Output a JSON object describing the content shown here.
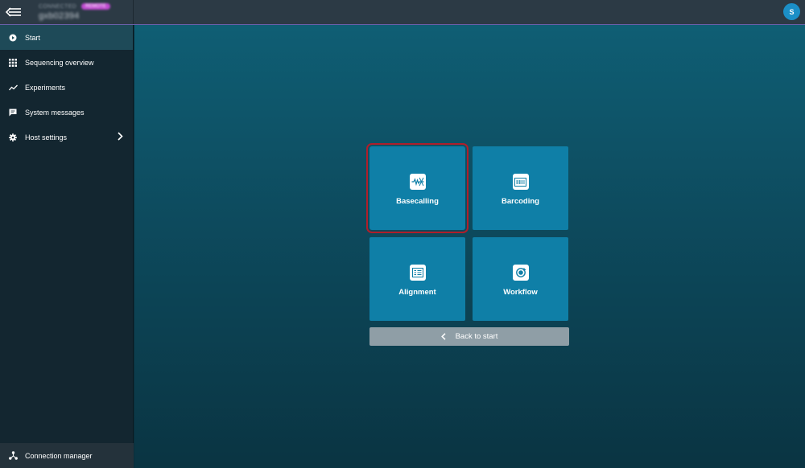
{
  "topbar": {
    "host_kind": "CONNECTED",
    "host_badge": "REMOTE",
    "host_name": "gxb02394",
    "avatar_initial": "S"
  },
  "sidebar": {
    "items": [
      {
        "label": "Start",
        "icon": "play-circle-icon",
        "active": true
      },
      {
        "label": "Sequencing overview",
        "icon": "grid-icon",
        "active": false
      },
      {
        "label": "Experiments",
        "icon": "trend-line-icon",
        "active": false
      },
      {
        "label": "System messages",
        "icon": "message-icon",
        "active": false
      },
      {
        "label": "Host settings",
        "icon": "gear-icon",
        "active": false,
        "has_submenu": true
      }
    ],
    "footer": {
      "label": "Connection manager",
      "icon": "network-icon"
    }
  },
  "main": {
    "tiles": [
      {
        "label": "Basecalling",
        "icon": "waveform-icon",
        "selected": true
      },
      {
        "label": "Barcoding",
        "icon": "barcode-icon",
        "selected": false
      },
      {
        "label": "Alignment",
        "icon": "align-list-icon",
        "selected": false
      },
      {
        "label": "Workflow",
        "icon": "workflow-cycle-icon",
        "selected": false
      }
    ],
    "back_button": {
      "label": "Back to start",
      "icon": "chevron-left-icon"
    }
  },
  "colors": {
    "accent": "#0f7fa7",
    "highlight": "#b01e2a",
    "sidebar_active": "#1e4a58",
    "avatar": "#1b8fc7"
  }
}
